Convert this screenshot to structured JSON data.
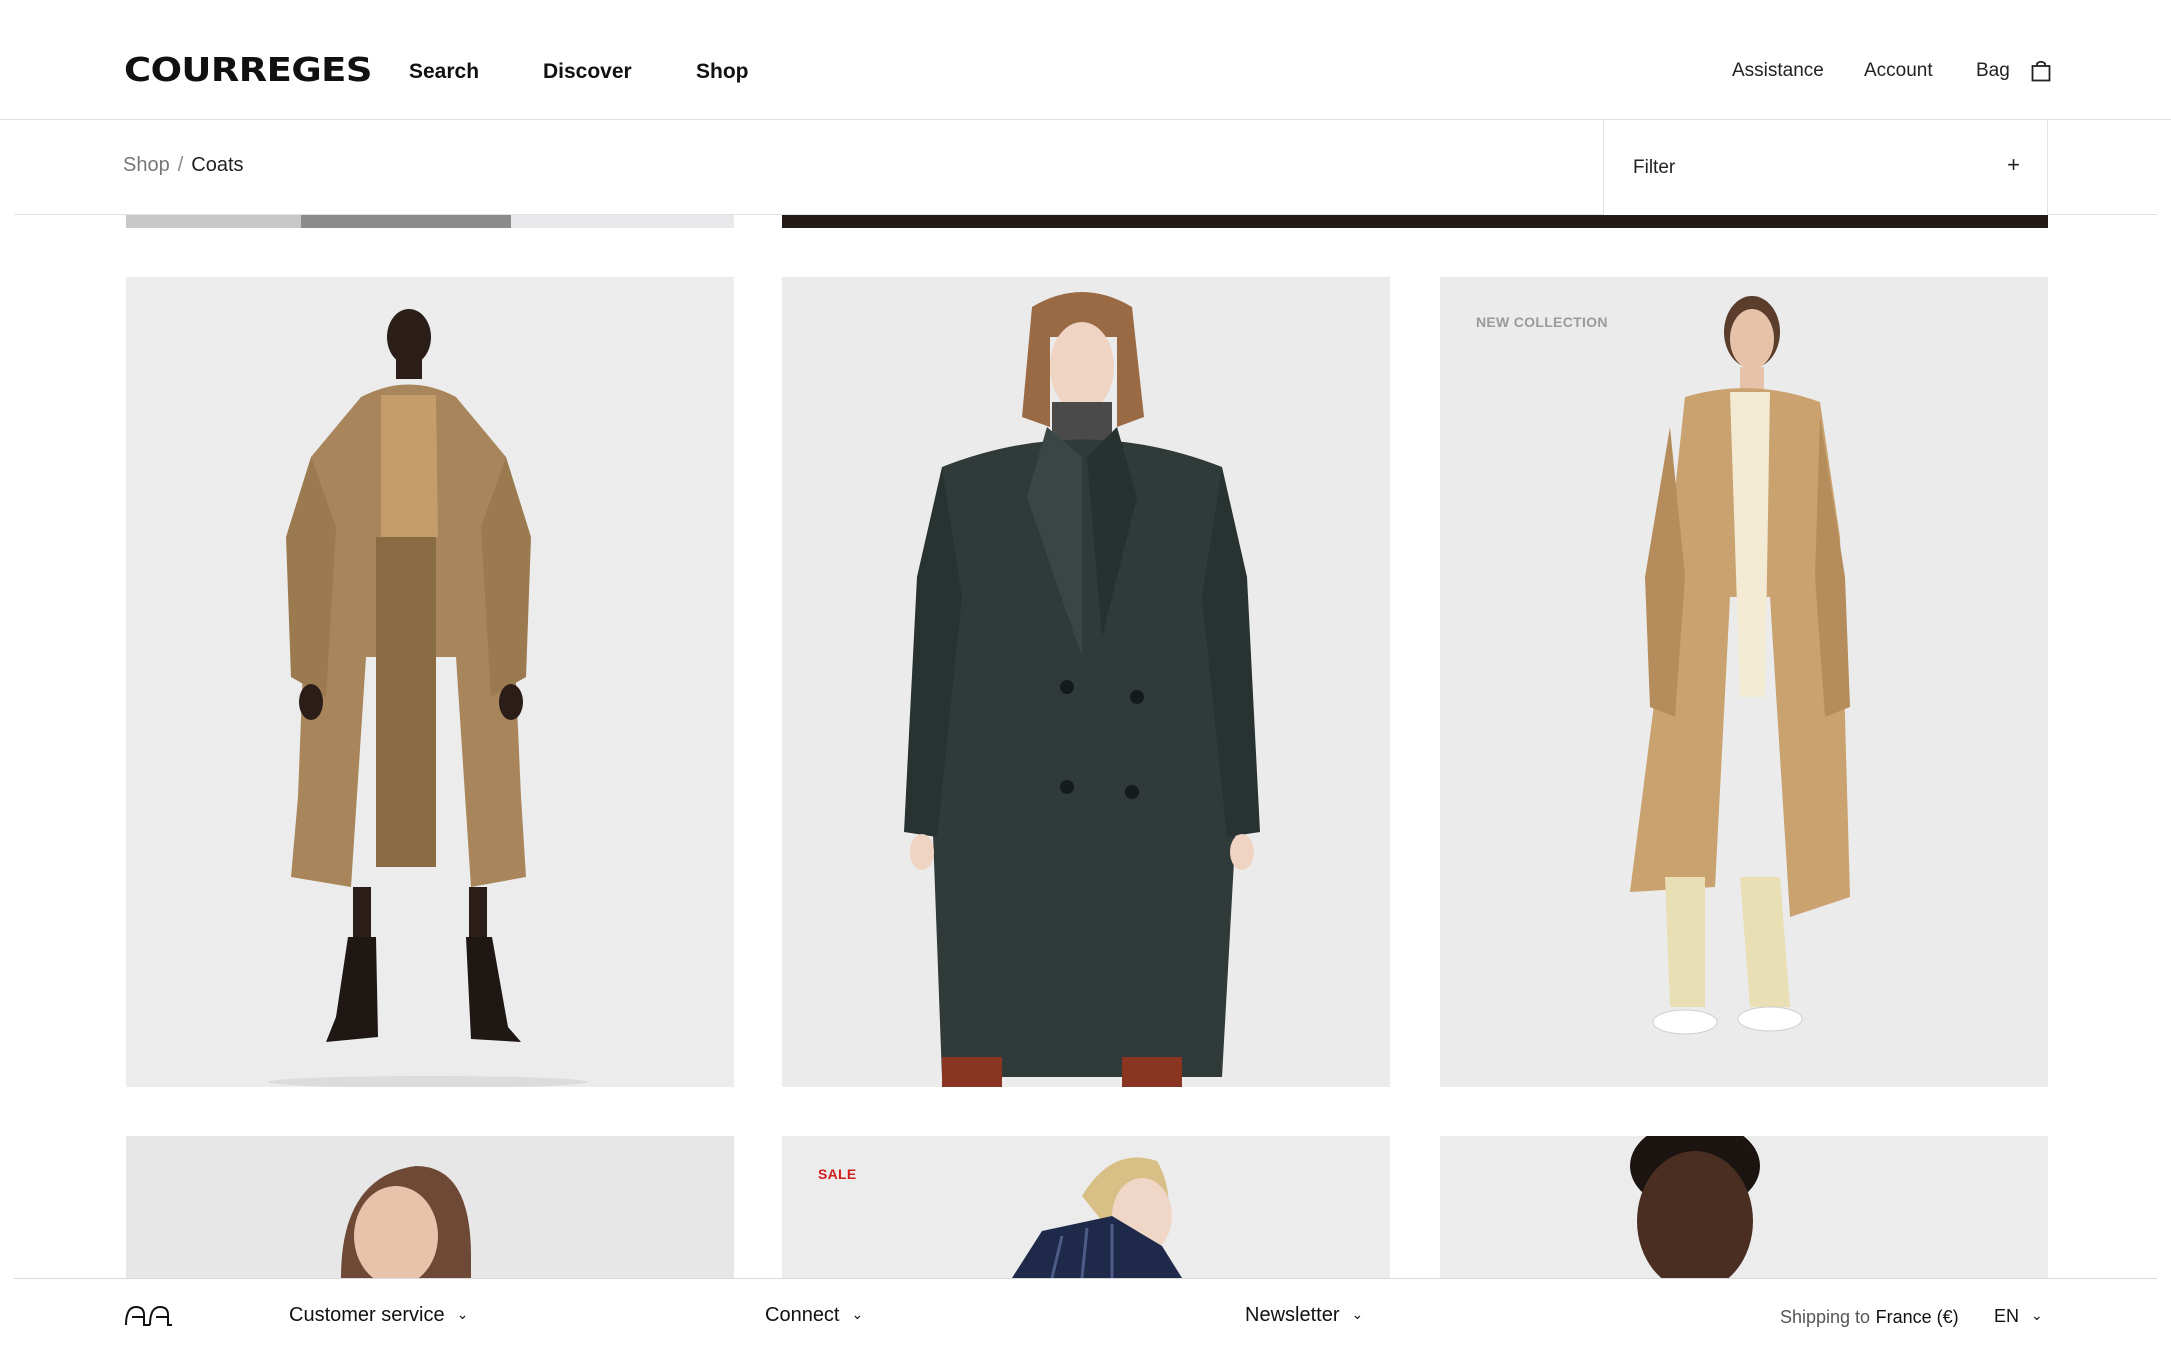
{
  "header": {
    "logo": "COURREGES",
    "nav": [
      "Search",
      "Discover",
      "Shop"
    ],
    "right_links": [
      "Assistance",
      "Account",
      "Bag"
    ],
    "bag_icon": "shopping-bag-icon"
  },
  "subheader": {
    "breadcrumb": {
      "parent": "Shop",
      "separator": "/",
      "current": "Coats"
    },
    "filter": {
      "label": "Filter",
      "toggle": "+"
    }
  },
  "products": {
    "row1": [
      {
        "badge": ""
      },
      {
        "badge": ""
      },
      {
        "badge": "NEW COLLECTION"
      }
    ],
    "row2": [
      {
        "badge": ""
      },
      {
        "badge": "SALE"
      },
      {
        "badge": ""
      }
    ]
  },
  "colors": {
    "sale": "#d0201f",
    "new_collection": "#9a9a9a",
    "tile_bg": "#ececec",
    "camel": "#b89a70",
    "charcoal": "#2f3a39",
    "light_camel": "#d5b388"
  },
  "footer": {
    "monogram_icon": "courreges-monogram-icon",
    "customer_service": "Customer service",
    "connect": "Connect",
    "newsletter": "Newsletter",
    "shipping_prefix": "Shipping to",
    "shipping_country": "France (€)",
    "language": "EN",
    "chevron": "⌄"
  }
}
